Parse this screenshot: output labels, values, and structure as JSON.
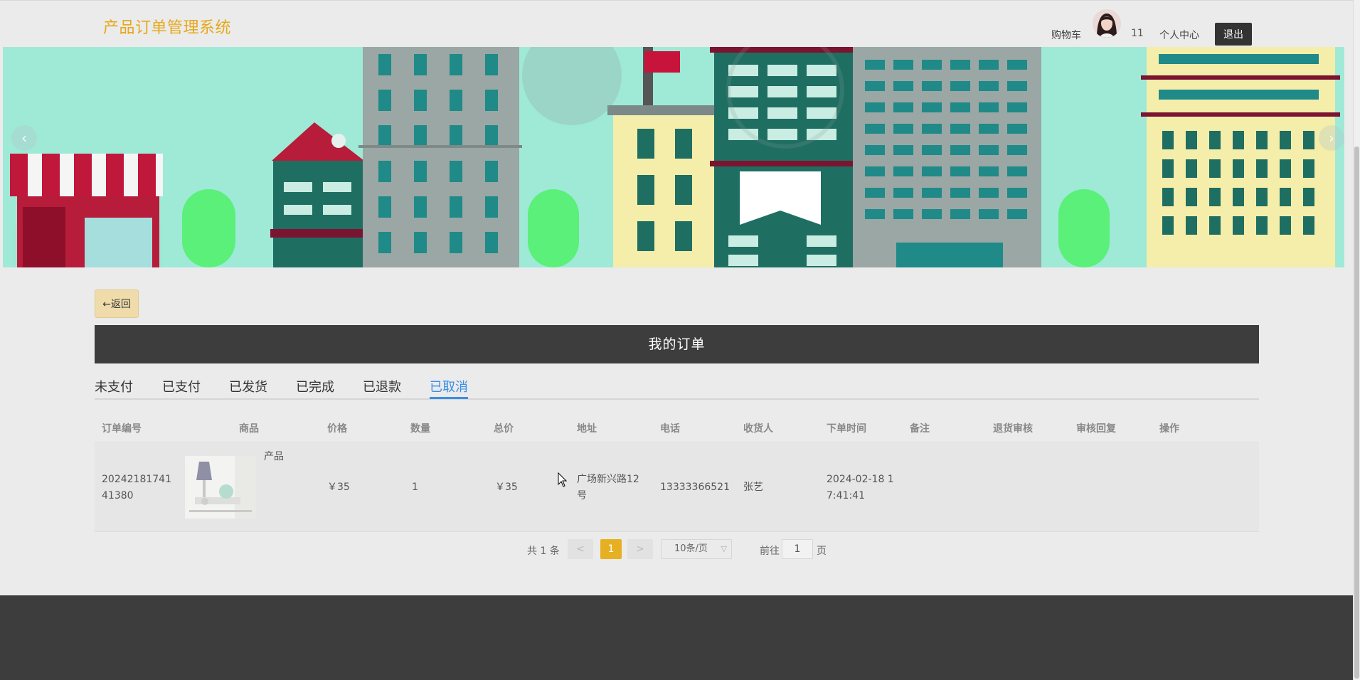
{
  "header": {
    "logo": "产品订单管理系统",
    "cart": "购物车",
    "username": "11",
    "profile": "个人中心",
    "logout": "退出"
  },
  "banner": {
    "prev": "‹",
    "next": "›"
  },
  "back_label": "←返回",
  "page_title": "我的订单",
  "tabs": [
    {
      "label": "未支付"
    },
    {
      "label": "已支付"
    },
    {
      "label": "已发货"
    },
    {
      "label": "已完成"
    },
    {
      "label": "已退款"
    },
    {
      "label": "已取消",
      "active": true
    }
  ],
  "table": {
    "headers": [
      "订单编号",
      "商品",
      "价格",
      "数量",
      "总价",
      "地址",
      "电话",
      "收货人",
      "下单时间",
      "备注",
      "退货审核",
      "审核回复",
      "操作"
    ],
    "rows": [
      {
        "order_no_1": "20242181741",
        "order_no_2": "41380",
        "product_name": "产品",
        "price": "￥35",
        "quantity": "1",
        "total": "￥35",
        "address_1": "广场新兴路12",
        "address_2": "号",
        "phone": "13333366521",
        "receiver": "张艺",
        "time_1": "2024-02-18 1",
        "time_2": "7:41:41",
        "remark": "",
        "return_review": "",
        "review_reply": "",
        "actions": ""
      }
    ]
  },
  "pagination": {
    "total_text": "共 1 条",
    "prev": "<",
    "current": "1",
    "next": ">",
    "page_size": "10条/页",
    "goto_label": "前往",
    "goto_value": "1",
    "page_suffix": "页"
  },
  "colors": {
    "logo": "#e6a817",
    "title_bar": "#3d3d3d",
    "tab_active": "#3a8ee6",
    "page_current": "#e6b022",
    "back_button": "#efdcaa"
  }
}
